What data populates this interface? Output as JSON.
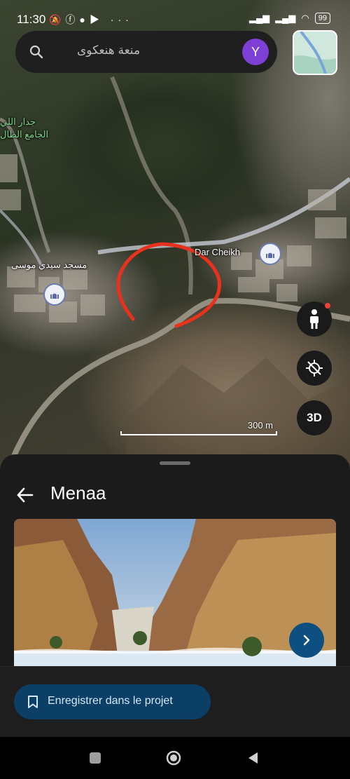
{
  "status_bar": {
    "time": "11:30",
    "battery": "99"
  },
  "search": {
    "query": "منعة هنعكوى",
    "avatar_letter": "Y"
  },
  "map": {
    "labels": {
      "place_dar_cheikh": "Dar Cheikh",
      "mosque_label": "مسجد سيدي موسى",
      "green_label_1": "جدار اللي",
      "green_label_2": "الجامع الطال"
    },
    "scale_label": "300 m",
    "annotation_color": "#e8321e"
  },
  "fabs": {
    "three_d_label": "3D"
  },
  "sheet": {
    "title": "Menaa",
    "save_label": "Enregistrer dans le projet"
  },
  "colors": {
    "accent_button": "#0b3f66",
    "avatar": "#7e3fd6"
  }
}
